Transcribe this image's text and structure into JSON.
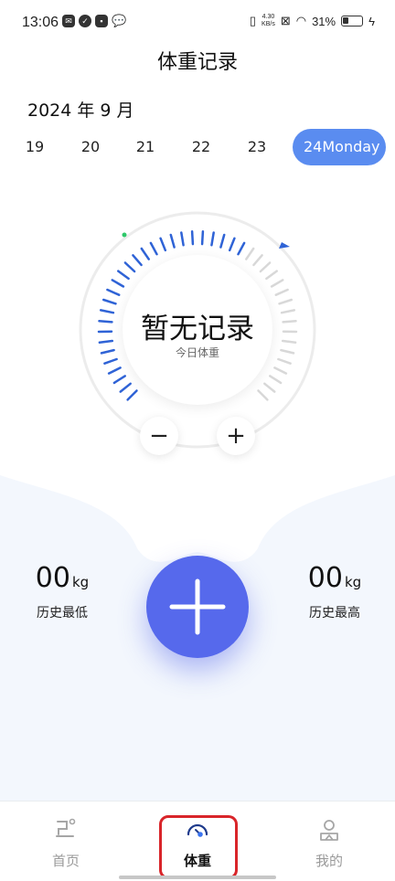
{
  "status_bar": {
    "time": "13:06",
    "net_speed": "4.30\nKB/s",
    "battery": "31%"
  },
  "header": {
    "title": "体重记录"
  },
  "calendar": {
    "month_label": "2024 年 9 月",
    "dates": [
      "19",
      "20",
      "21",
      "22",
      "23"
    ],
    "selected_date": "24Monday"
  },
  "gauge": {
    "status_text": "暂无记录",
    "sub_label": "今日体重",
    "accent_color": "#2f63d6",
    "inactive_color": "#d8d8d8",
    "minus_label": "−",
    "plus_label": "+"
  },
  "stats": {
    "lowest_value": "00",
    "lowest_unit": "kg",
    "lowest_label": "历史最低",
    "highest_value": "00",
    "highest_unit": "kg",
    "highest_label": "历史最高"
  },
  "add_button": {
    "icon": "plus-icon",
    "color": "#5669ec"
  },
  "tab_bar": {
    "items": [
      {
        "label": "首页",
        "icon": "home-icon"
      },
      {
        "label": "体重",
        "icon": "gauge-icon",
        "active": true
      },
      {
        "label": "我的",
        "icon": "profile-icon"
      }
    ]
  }
}
